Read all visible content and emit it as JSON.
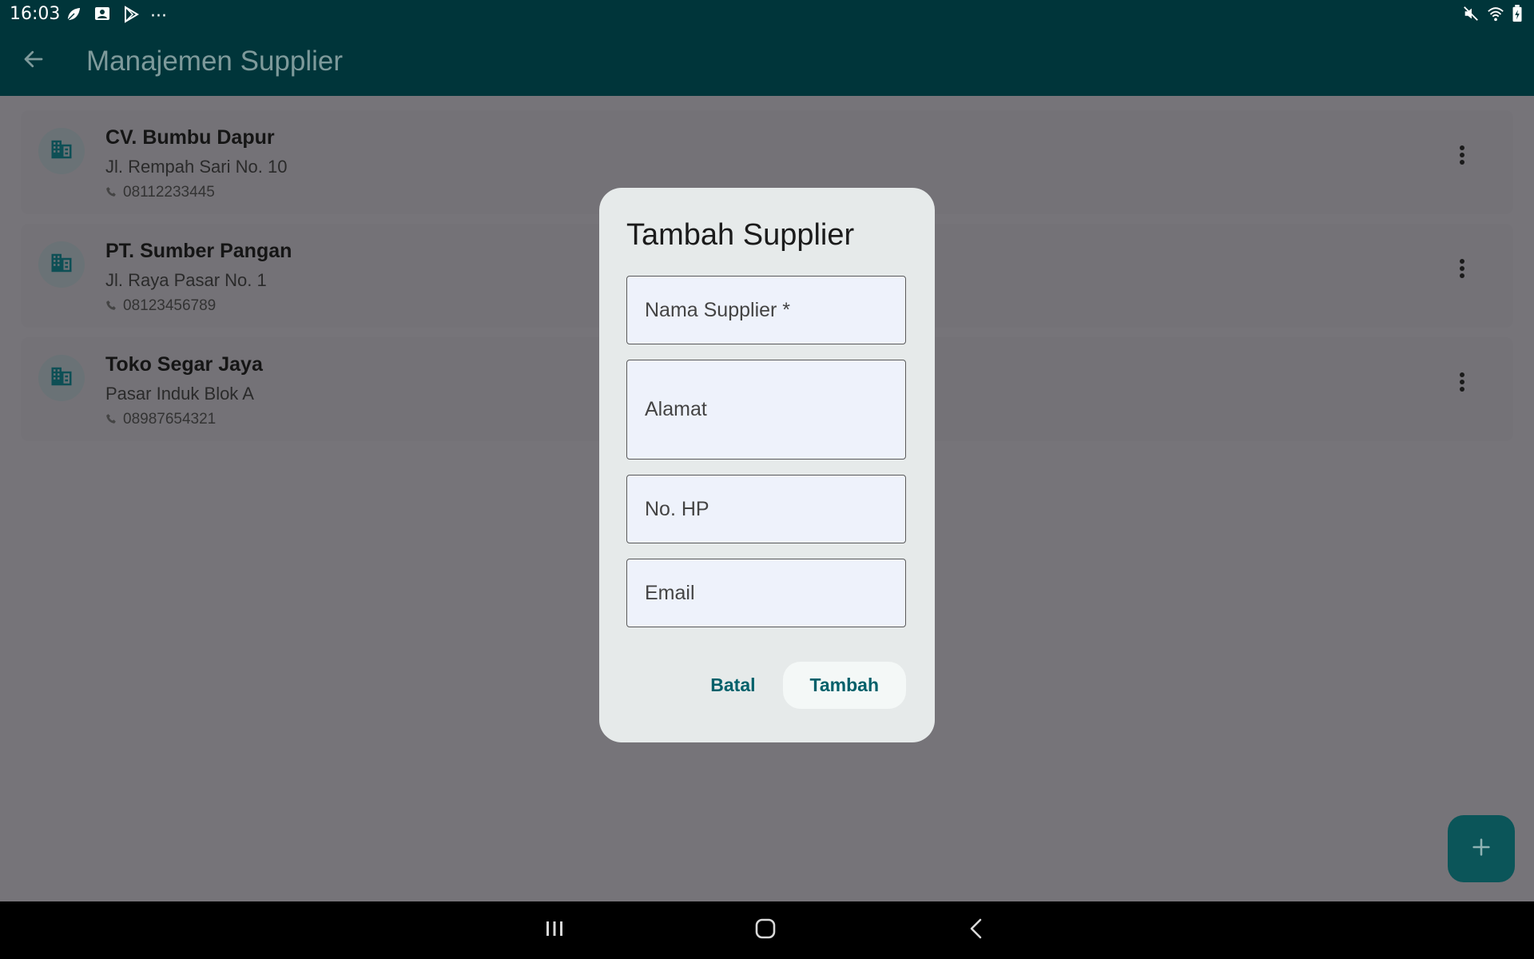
{
  "status_bar": {
    "time": "16:03",
    "left_icons": [
      "leaf-icon",
      "notification-icon",
      "play-store-icon",
      "more-dots-icon"
    ],
    "more_label": "···",
    "right_icons": [
      "mute-icon",
      "wifi-icon",
      "battery-icon"
    ]
  },
  "app_bar": {
    "title": "Manajemen Supplier",
    "color": "#00353a"
  },
  "suppliers": [
    {
      "name": "CV. Bumbu Dapur",
      "address": "Jl. Rempah Sari No. 10",
      "phone": "08112233445"
    },
    {
      "name": "PT. Sumber Pangan",
      "address": "Jl. Raya Pasar No. 1",
      "phone": "08123456789"
    },
    {
      "name": "Toko Segar Jaya",
      "address": "Pasar Induk Blok A",
      "phone": "08987654321"
    }
  ],
  "dialog": {
    "title": "Tambah Supplier",
    "fields": {
      "name_placeholder": "Nama Supplier *",
      "name_value": "",
      "address_placeholder": "Alamat",
      "address_value": "",
      "phone_placeholder": "No. HP",
      "phone_value": "",
      "email_placeholder": "Email",
      "email_value": ""
    },
    "cancel_label": "Batal",
    "submit_label": "Tambah"
  },
  "fab": {
    "icon": "plus-icon"
  },
  "nav_bar": {
    "icons": [
      "recent-apps-icon",
      "home-icon",
      "back-icon"
    ]
  },
  "colors": {
    "primary": "#00606a",
    "appbar": "#00353a",
    "scrim_background": "#767479",
    "dialog_surface": "#e6eaea"
  }
}
